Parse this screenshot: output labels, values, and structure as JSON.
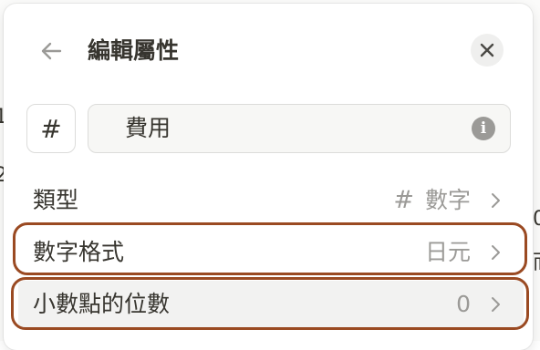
{
  "panel": {
    "title": "編輯屬性",
    "back_icon": "arrow-left-icon",
    "close_icon": "close-icon"
  },
  "property": {
    "icon_glyph": "#",
    "name": "費用",
    "info_icon_glyph": "i"
  },
  "settings": [
    {
      "label": "類型",
      "value": "數字",
      "value_icon": "#"
    },
    {
      "label": "數字格式",
      "value": "日元"
    },
    {
      "label": "小數點的位數",
      "value": "0"
    }
  ],
  "background_fragments": [
    "1",
    "2",
    "0",
    "而"
  ],
  "colors": {
    "highlight": "#9a4a22",
    "text": "#37352f",
    "muted": "#9b9a97",
    "field_bg": "#f7f7f5",
    "hover_bg": "#f2f2f1"
  }
}
